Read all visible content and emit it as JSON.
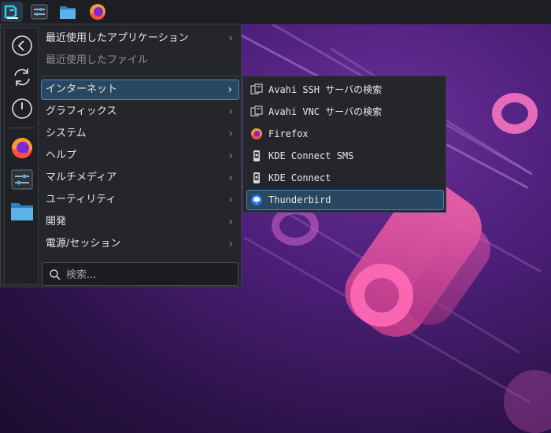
{
  "panel": {
    "icons": [
      "app-launcher-icon",
      "system-settings-icon",
      "file-manager-icon",
      "firefox-icon"
    ]
  },
  "favorites": [
    "back-icon",
    "refresh-icon",
    "power-icon",
    "firefox-icon",
    "system-settings-icon",
    "file-manager-icon"
  ],
  "menu": {
    "recent_apps": "最近使用したアプリケーション",
    "recent_files": "最近使用したファイル",
    "categories": [
      "インターネット",
      "グラフィックス",
      "システム",
      "ヘルプ",
      "マルチメディア",
      "ユーティリティ",
      "開発",
      "電源/セッション"
    ],
    "selected_category": "インターネット",
    "search_placeholder": "検索..."
  },
  "submenu": {
    "items": [
      "Avahi SSH サーバの検索",
      "Avahi VNC サーバの検索",
      "Firefox",
      "KDE Connect SMS",
      "KDE Connect",
      "Thunderbird"
    ],
    "selected": "Thunderbird"
  },
  "colors": {
    "accent": "#3d88c8",
    "selection_bg": "#2a4761",
    "menu_bg": "#24262b"
  }
}
